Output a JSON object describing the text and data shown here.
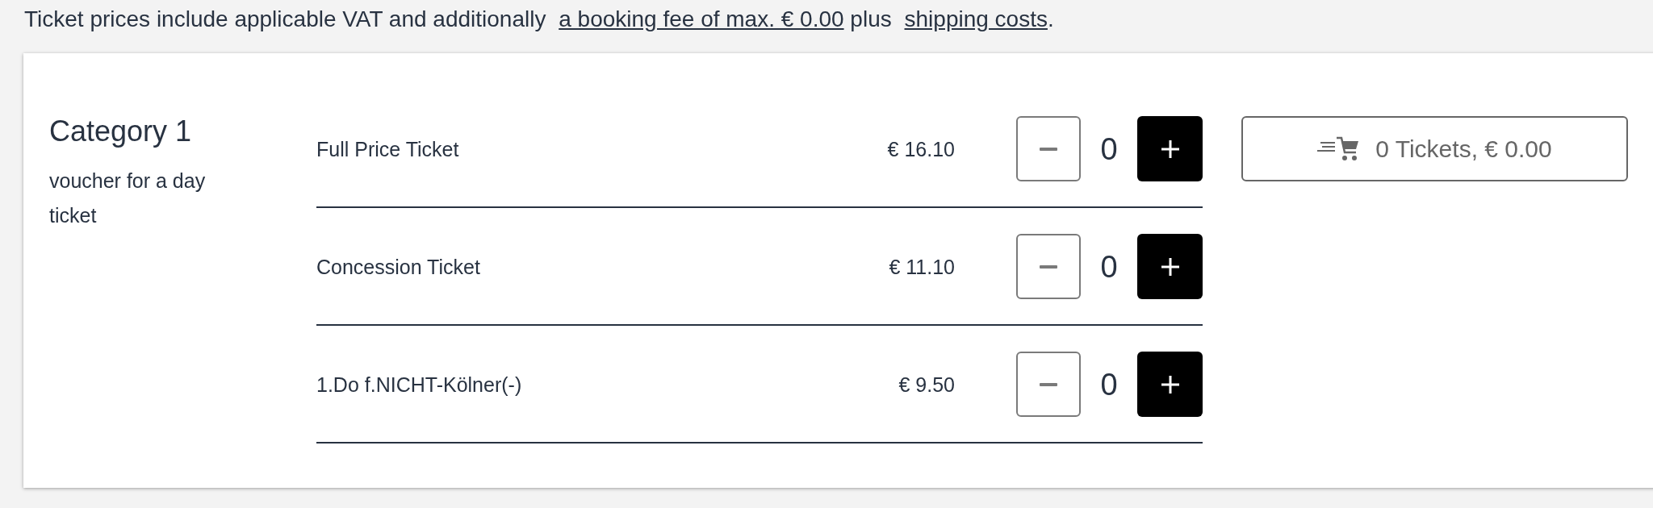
{
  "notice": {
    "lead": "Ticket prices include applicable VAT and additionally",
    "fee_link": "a booking fee of max. € 0.00",
    "middle": "plus",
    "shipping_link": "shipping costs",
    "end": "."
  },
  "category": {
    "title": "Category 1",
    "description": "voucher for a day ticket"
  },
  "tickets": [
    {
      "name": "Full Price Ticket",
      "price": "€ 16.10",
      "quantity": "0",
      "decrease_disabled": true
    },
    {
      "name": "Concession Ticket",
      "price": "€ 11.10",
      "quantity": "0",
      "decrease_disabled": true
    },
    {
      "name": "1.Do f.NICHT-Kölner(-)",
      "price": "€ 9.50",
      "quantity": "0",
      "decrease_disabled": true
    }
  ],
  "cart": {
    "summary": "0 Tickets, € 0.00"
  }
}
